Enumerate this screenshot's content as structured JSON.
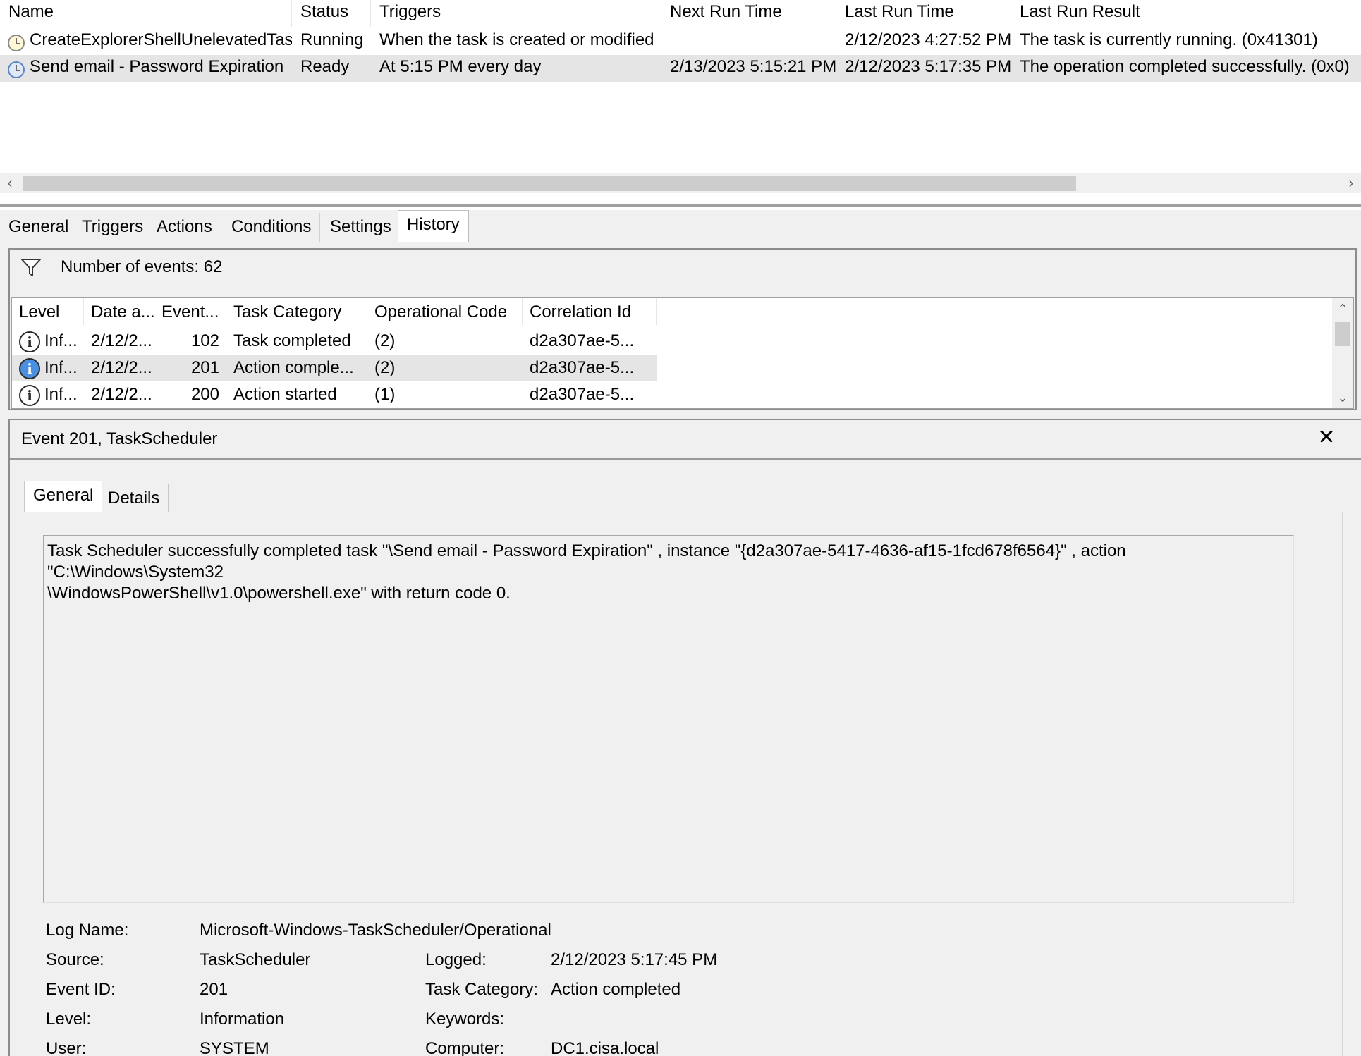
{
  "tasks": {
    "columns": [
      "Name",
      "Status",
      "Triggers",
      "Next Run Time",
      "Last Run Time",
      "Last Run Result"
    ],
    "rows": [
      {
        "name": "CreateExplorerShellUnelevatedTask",
        "status": "Running",
        "triggers": "When the task is created or modified",
        "next_run": "",
        "last_run": "2/12/2023 4:27:52 PM",
        "result": "The task is currently running. (0x41301)",
        "icon": "task-clock-icon"
      },
      {
        "name": "Send email - Password Expiration",
        "status": "Ready",
        "triggers": "At 5:15 PM every day",
        "next_run": "2/13/2023 5:15:21 PM",
        "last_run": "2/12/2023 5:17:35 PM",
        "result": "The operation completed successfully. (0x0)",
        "icon": "task-clock-icon"
      }
    ]
  },
  "main_tabs": [
    "General",
    "Triggers",
    "Actions",
    "Conditions",
    "Settings",
    "History"
  ],
  "history": {
    "event_count": "Number of events: 62",
    "columns": [
      "Level",
      "Date a...",
      "Event...",
      "Task Category",
      "Operational Code",
      "Correlation Id"
    ],
    "rows": [
      {
        "level": "Inf...",
        "date": "2/12/2...",
        "event": "102",
        "category": "Task completed",
        "opcode": "(2)",
        "correlation": "d2a307ae-5..."
      },
      {
        "level": "Inf...",
        "date": "2/12/2...",
        "event": "201",
        "category": "Action comple...",
        "opcode": "(2)",
        "correlation": "d2a307ae-5..."
      },
      {
        "level": "Inf...",
        "date": "2/12/2...",
        "event": "200",
        "category": "Action started",
        "opcode": "(1)",
        "correlation": "d2a307ae-5..."
      }
    ]
  },
  "detail": {
    "title": "Event 201, TaskScheduler",
    "tabs": [
      "General",
      "Details"
    ],
    "message_line1": "Task Scheduler successfully completed task \"\\Send email - Password Expiration\" , instance \"{d2a307ae-5417-4636-af15-1fcd678f6564}\" , action \"C:\\Windows\\System32",
    "message_line2": "\\WindowsPowerShell\\v1.0\\powershell.exe\" with return code 0.",
    "props": {
      "log_name_label": "Log Name:",
      "log_name": "Microsoft-Windows-TaskScheduler/Operational",
      "source_label": "Source:",
      "source": "TaskScheduler",
      "logged_label": "Logged:",
      "logged": "2/12/2023 5:17:45 PM",
      "event_id_label": "Event ID:",
      "event_id": "201",
      "task_category_label": "Task Category:",
      "task_category": "Action completed",
      "level_label": "Level:",
      "level": "Information",
      "keywords_label": "Keywords:",
      "keywords": "",
      "user_label": "User:",
      "user": "SYSTEM",
      "computer_label": "Computer:",
      "computer": "DC1.cisa.local"
    }
  },
  "colors": {
    "selected_row": "#e5e5e5",
    "panel_bg": "#f0f0f0",
    "info_selected": "#4b8fe0"
  }
}
